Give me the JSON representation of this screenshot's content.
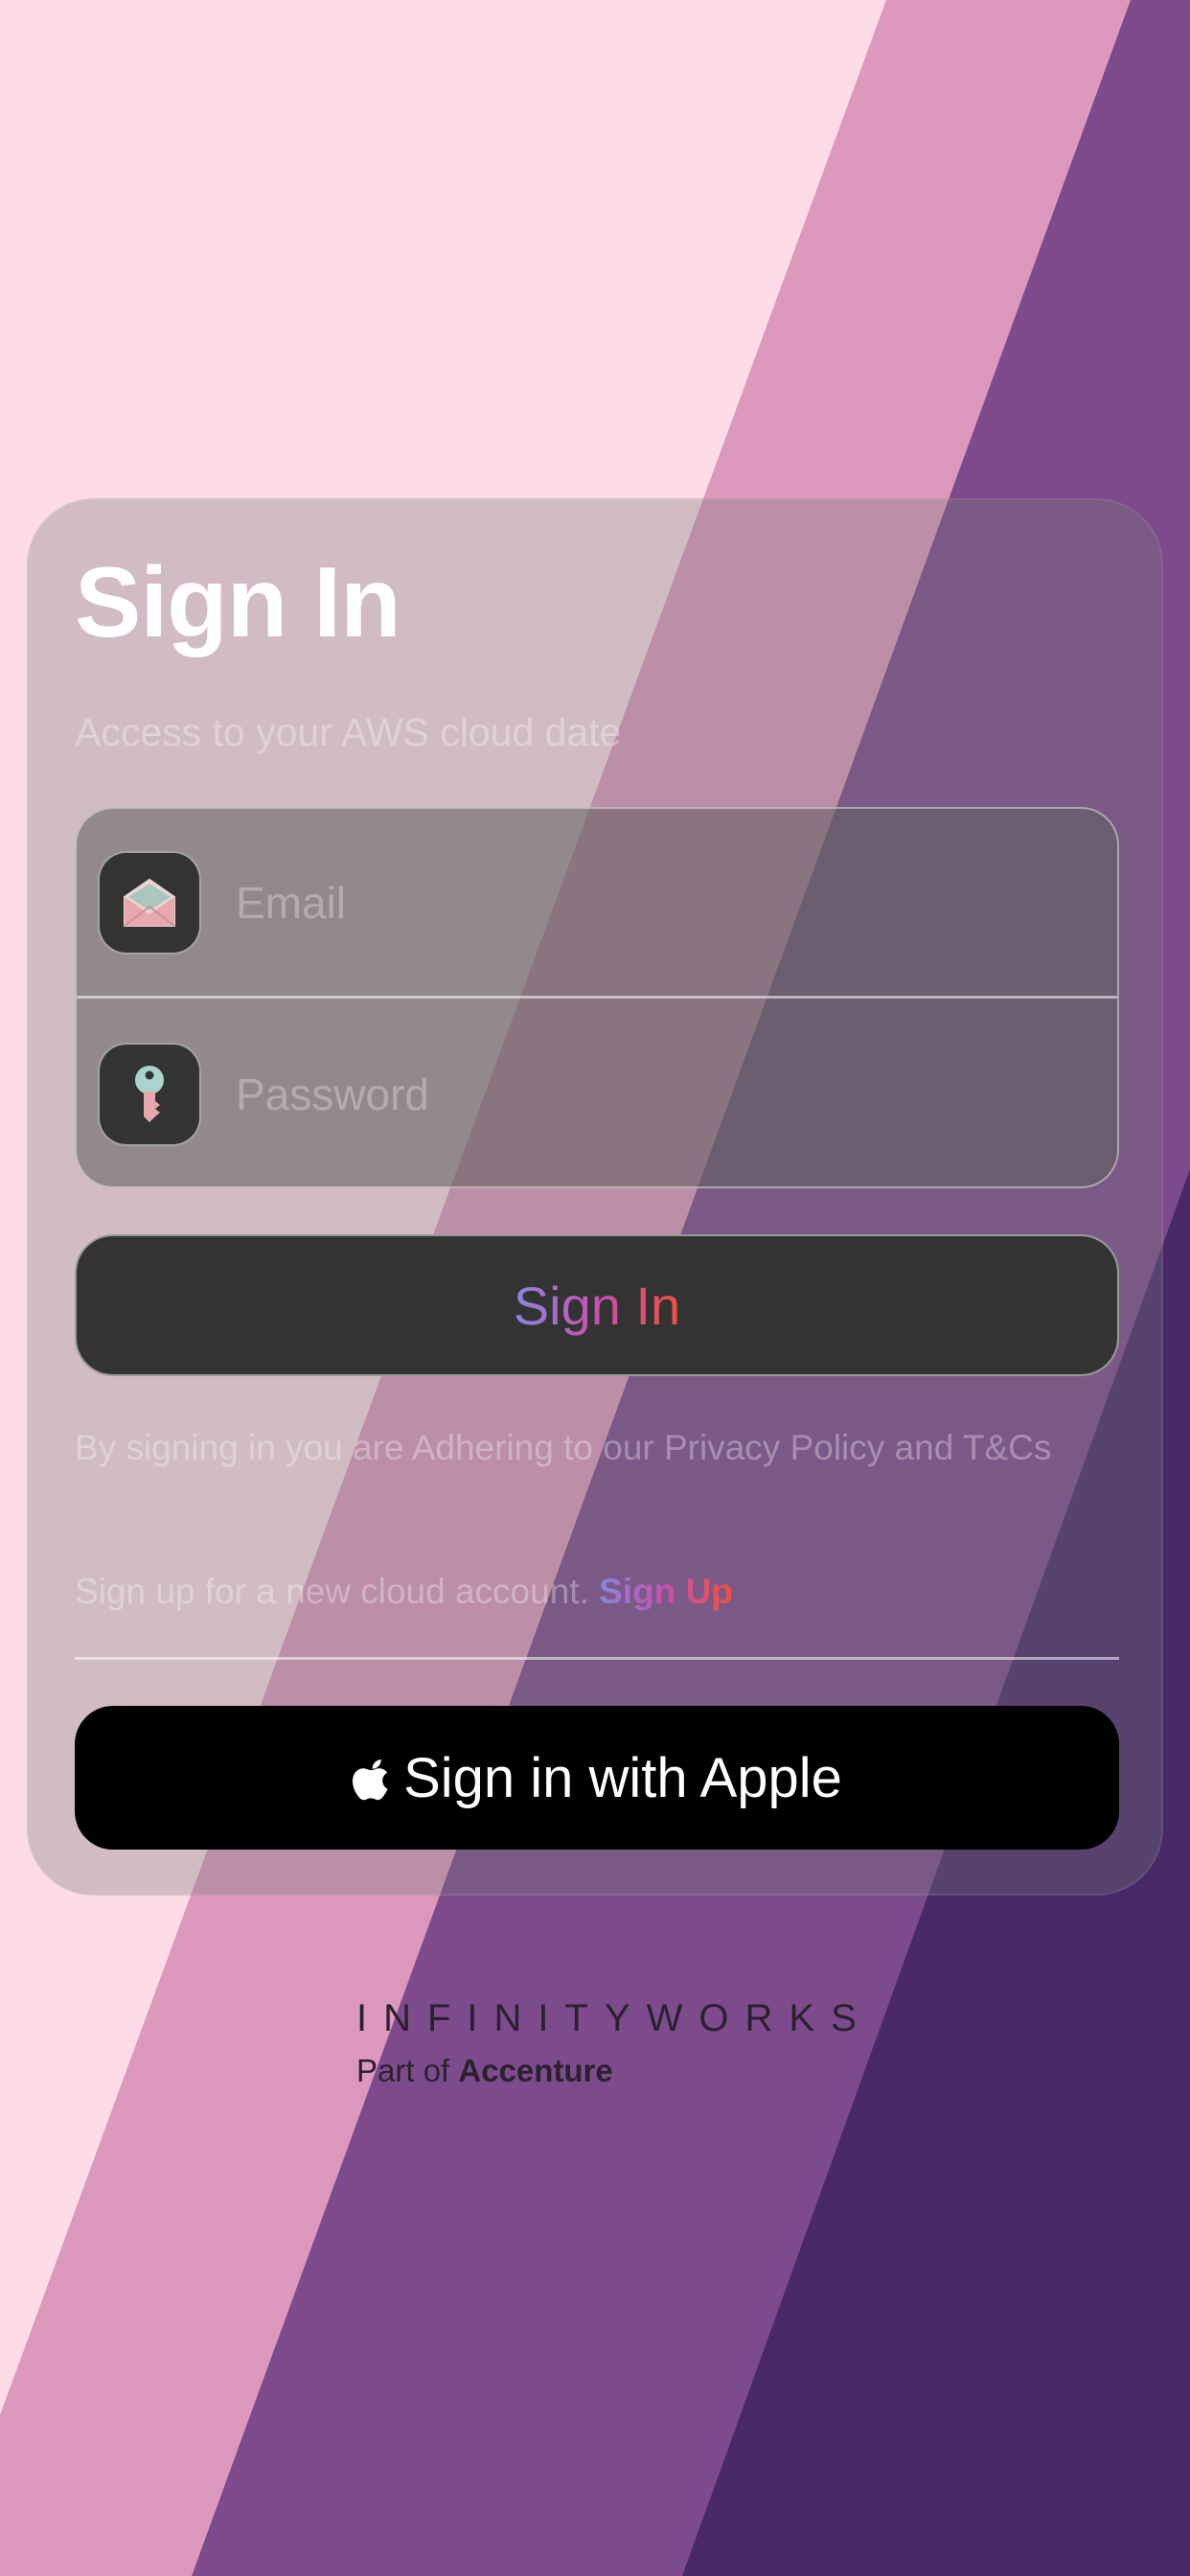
{
  "colors": {
    "background_light": "#fddce8",
    "band_pink": "#dd98bd",
    "band_purple": "#7d4b8c",
    "band_dark_purple": "#482869",
    "button_dark": "#333333",
    "apple_button": "#000000",
    "gradient": [
      "#8a86dd",
      "#c84fb0",
      "#f0503c"
    ]
  },
  "signin": {
    "title": "Sign In",
    "subtitle": "Access to your AWS cloud date",
    "email": {
      "placeholder": "Email",
      "icon": "envelope-open-icon"
    },
    "password": {
      "placeholder": "Password",
      "icon": "key-icon"
    },
    "button_label": "Sign In",
    "legal_text": "By signing in you are Adhering  to our Privacy Policy and T&Cs",
    "signup_prompt": "Sign up for a new cloud account.",
    "signup_link": "Sign Up",
    "apple_button_label": "Sign in with Apple",
    "apple_icon": "apple-logo-icon"
  },
  "brand": {
    "name": "INFINITYWORKS",
    "part_of_prefix": "Part of",
    "parent_company": "Accenture"
  }
}
